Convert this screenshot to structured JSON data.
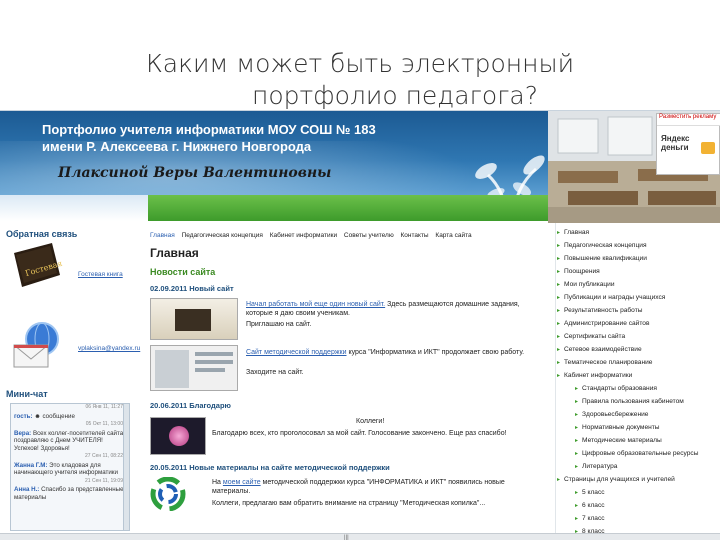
{
  "slide": {
    "title_line1": "Каким может быть электронный",
    "title_line2": "портфолио педагога?"
  },
  "site": {
    "banner_title": "Портфолио учителя информатики МОУ СОШ № 183 имени Р. Алексеева г. Нижнего Новгорода",
    "teacher_name": "Плаксиной Веры Валентиновны",
    "ad_label": "Разместить рекламу",
    "ad_text": "Яндекс деньги"
  },
  "left": {
    "feedback_heading": "Обратная связь",
    "guestbook_link": "Гостевая книга",
    "guestbook_icon_text": "Гостевая Книга",
    "email_link": "vplaksina@yandex.ru",
    "minichat_heading": "Мини-чат",
    "chat": [
      {
        "date": "06 Янв 11, 11:27",
        "who": "гость:",
        "text": "сообщение"
      },
      {
        "date": "05 Окт 11, 13:00",
        "who": "Вера:",
        "text": "Всех коллег-посетителей сайта поздравляю с Днем УЧИТЕЛЯ! Успехов! Здоровья!"
      },
      {
        "date": "27 Сен 11, 08:22",
        "who": "Жанна Г.М:",
        "text": "Это кладовая для начинающего учителя информатики"
      },
      {
        "date": "21 Сен 11, 19:09",
        "who": "Анна Н.:",
        "text": "Спасибо за представленные материалы"
      }
    ]
  },
  "content": {
    "topnav": [
      "Главная",
      "Педагогическая концепция",
      "Кабинет информатики",
      "Советы учителю",
      "Контакты",
      "Карта сайта"
    ],
    "page_heading": "Главная",
    "news_heading": "Новости сайта",
    "news": [
      {
        "title": "02.09.2011 Новый сайт",
        "p1_link": "Начал работать мой еще один новый сайт.",
        "p1_rest": "Здесь размещаются домашние задания, которые я даю своим ученикам.",
        "p2": "Приглашаю на сайт.",
        "p3_link": "Сайт методической поддержки",
        "p3_rest": "курса \"Информатика и ИКТ\" продолжает свою работу.",
        "p4": "Заходите на сайт."
      },
      {
        "title": "20.06.2011 Благодарю",
        "heading": "Коллеги!",
        "text": "Благодарю всех, кто проголосовал за мой сайт. Голосование закончено. Еще раз спасибо!"
      },
      {
        "title": "20.05.2011 Новые материалы на сайте методической поддержки",
        "p1_pre": "На",
        "p1_link": "моем сайте",
        "p1_rest": "методической поддержки курса \"ИНФОРМАТИКА и ИКТ\" появились новые материалы.",
        "p2": "Коллеги, предлагаю вам обратить внимание на страницу \"Методическая копилка\"..."
      }
    ]
  },
  "rightnav": {
    "items": [
      "Главная",
      "Педагогическая концепция",
      "Повышение квалификации",
      "Поощрения",
      "Мои публикации",
      "Публикации и награды учащихся",
      "Результативность работы",
      "Администрирование сайтов",
      "Сертификаты сайта",
      "Сетевое взаимодействие",
      "Тематическое планирование",
      "Кабинет информатики"
    ],
    "subitems": [
      "Стандарты образования",
      "Правила пользования кабинетом",
      "Здоровьесбережение",
      "Нормативные документы",
      "Методические материалы",
      "Цифровые образовательные ресурсы",
      "Литература"
    ],
    "item_students": "Страницы для учащихся и учителей",
    "grades": [
      "5 класс",
      "6 класс",
      "7 класс",
      "8 класс"
    ]
  },
  "scrollbar": {
    "grip": "|||"
  }
}
